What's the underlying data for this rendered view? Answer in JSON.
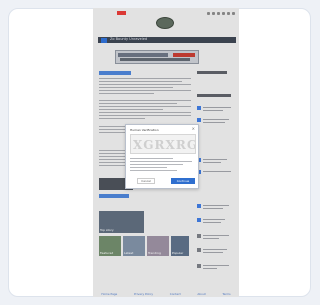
{
  "site": {
    "nav_title": "Zo Bounty Unraveled",
    "footer_links": [
      "Home Page",
      "Privacy Policy",
      "Contact",
      "About",
      "Terms"
    ]
  },
  "modal": {
    "title": "Human Verification",
    "captcha_text": "XGRXRG",
    "cancel_label": "Cancel",
    "ok_label": "Continue"
  },
  "thumbnails": [
    {
      "caption": "Top story"
    },
    {
      "caption": "Featured"
    },
    {
      "caption": "Latest"
    },
    {
      "caption": "Trending"
    },
    {
      "caption": "Popular"
    }
  ],
  "colors": {
    "accent": "#2f6fcf",
    "nav_bg": "#3b4350",
    "badge": "#e53935"
  }
}
